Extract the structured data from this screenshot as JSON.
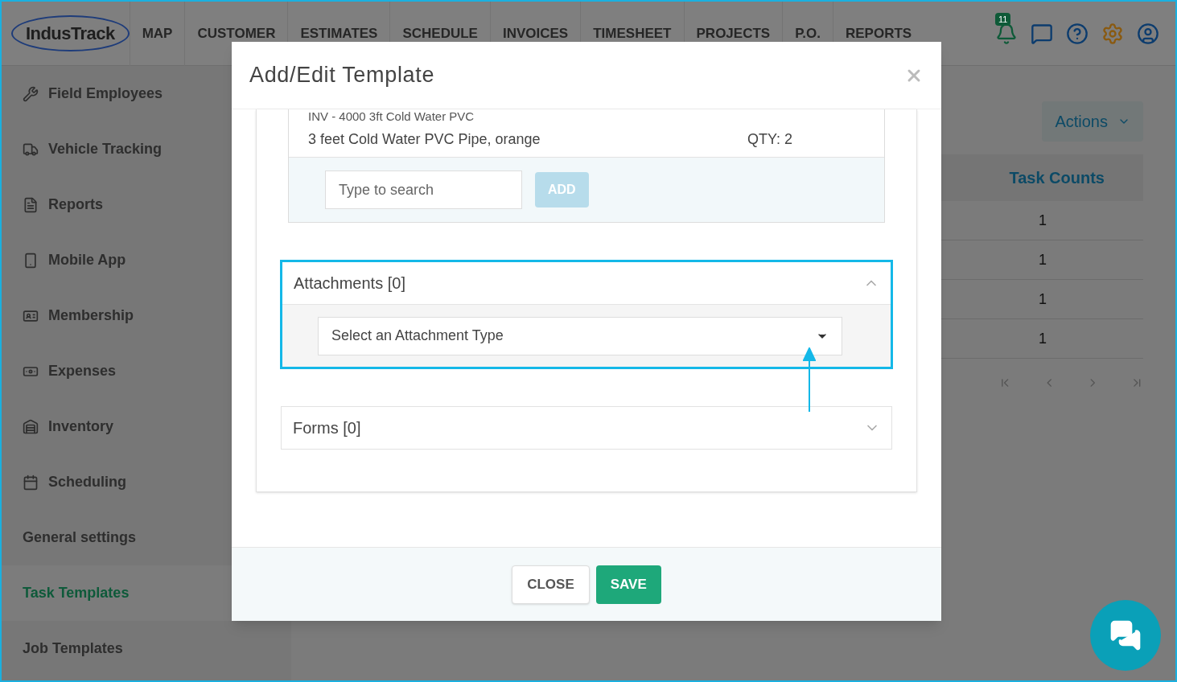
{
  "nav": {
    "logo": "IndusTrack",
    "items": [
      "MAP",
      "CUSTOMER",
      "ESTIMATES",
      "SCHEDULE",
      "INVOICES",
      "TIMESHEET",
      "PROJECTS",
      "P.O.",
      "REPORTS"
    ],
    "notifications": "11"
  },
  "sidebar": {
    "items": [
      {
        "label": "Field Employees",
        "selected": false
      },
      {
        "label": "Vehicle Tracking",
        "selected": false
      },
      {
        "label": "Reports",
        "selected": false
      },
      {
        "label": "Mobile App",
        "selected": false
      },
      {
        "label": "Membership",
        "selected": false
      },
      {
        "label": "Expenses",
        "selected": false
      },
      {
        "label": "Inventory",
        "selected": false
      },
      {
        "label": "Scheduling",
        "selected": false
      },
      {
        "label": "General settings",
        "selected": false
      },
      {
        "label": "Task Templates",
        "selected": true
      },
      {
        "label": "Job Templates",
        "selected": false
      }
    ]
  },
  "main": {
    "actions": "Actions",
    "table": {
      "columns": [
        "Task Counts"
      ],
      "rows": [
        [
          "1"
        ],
        [
          "1"
        ],
        [
          "1"
        ],
        [
          "1"
        ]
      ]
    }
  },
  "modal": {
    "title": "Add/Edit Template",
    "items": {
      "cut_line": "INV - 4000 3ft Cold Water PVC",
      "description": "3 feet Cold Water PVC Pipe, orange",
      "qty": "QTY: 2",
      "search": {
        "placeholder": "Type to search"
      },
      "add_button": {
        "label": "ADD",
        "disabled": true
      }
    },
    "sections": [
      {
        "title": "Attachments [0]",
        "expanded": true,
        "highlighted": true,
        "select_placeholder": "Select an Attachment Type"
      },
      {
        "title": "Forms [0]",
        "expanded": false,
        "highlighted": false
      }
    ],
    "buttons": [
      {
        "label": "CLOSE",
        "kind": "secondary"
      },
      {
        "label": "SAVE",
        "kind": "primary"
      }
    ]
  }
}
